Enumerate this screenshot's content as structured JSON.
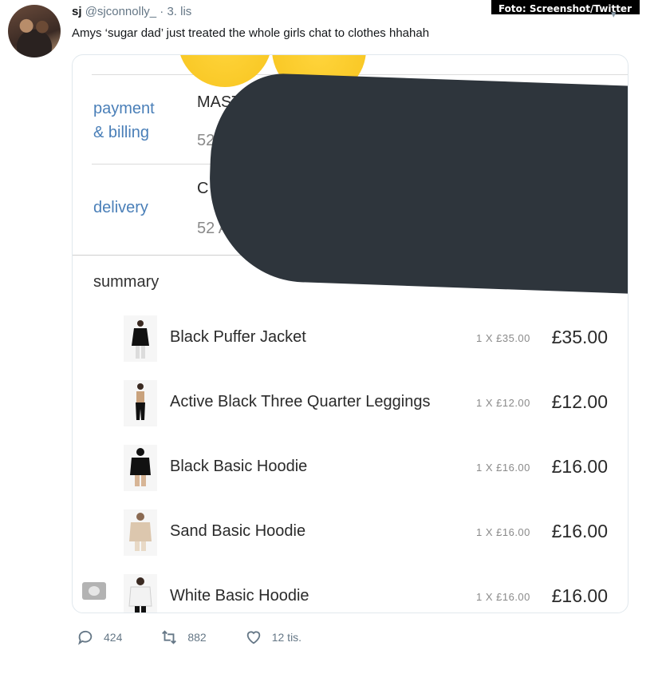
{
  "watermark": "Foto: Screenshot/Twitter",
  "tweet": {
    "name": "sj",
    "handle": "@sjconnolly_",
    "separator": "·",
    "date": "3. lis",
    "text": "Amys ‘sugar dad’ just treated the whole girls chat to clothes hhahah",
    "chevron_icon": "chevron-down-icon"
  },
  "receipt": {
    "payment_label_line1": "payment",
    "payment_label_line2": "& billing",
    "payment_value": "MAST",
    "payment_sub": "52",
    "delivery_label": "delivery",
    "delivery_value": "C",
    "delivery_sub": "52 A",
    "summary_title": "summary",
    "items": [
      {
        "name": "Black Puffer Jacket",
        "qty": "1 X £35.00",
        "price": "£35.00"
      },
      {
        "name": "Active Black Three Quarter Leggings",
        "qty": "1 X £12.00",
        "price": "£12.00"
      },
      {
        "name": "Black Basic Hoodie",
        "qty": "1 X £16.00",
        "price": "£16.00"
      },
      {
        "name": "Sand Basic Hoodie",
        "qty": "1 X £16.00",
        "price": "£16.00"
      },
      {
        "name": "White Basic Hoodie",
        "qty": "1 X £16.00",
        "price": "£16.00"
      }
    ]
  },
  "actions": {
    "replies": "424",
    "retweets": "882",
    "likes": "12 tis."
  },
  "colors": {
    "label_blue": "#4a7fb8",
    "blackout": "#2e353c",
    "emoji_yellow": "#f6c31c",
    "icon_grey": "#657786"
  }
}
